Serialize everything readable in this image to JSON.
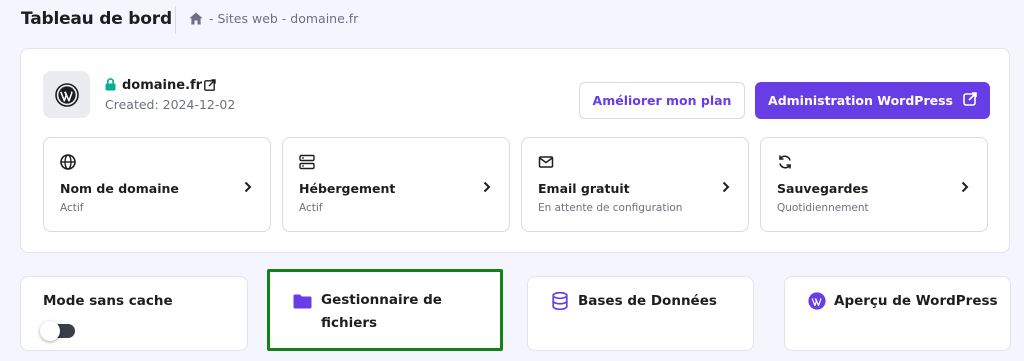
{
  "header": {
    "title": "Tableau de bord",
    "breadcrumb": "- Sites web - domaine.fr"
  },
  "site": {
    "name": "domaine.fr",
    "created": "Created: 2024-12-02",
    "logo_icon": "wordpress-icon",
    "lock_icon": "lock-icon",
    "external_icon": "external-link-icon"
  },
  "actions": {
    "upgrade_label": "Améliorer mon plan",
    "wp_admin_label": "Administration WordPress"
  },
  "services": [
    {
      "icon": "globe-icon",
      "title": "Nom de domaine",
      "status": "Actif"
    },
    {
      "icon": "server-icon",
      "title": "Hébergement",
      "status": "Actif"
    },
    {
      "icon": "mail-icon",
      "title": "Email gratuit",
      "status": "En attente de configuration"
    },
    {
      "icon": "refresh-icon",
      "title": "Sauvegardes",
      "status": "Quotidiennement"
    }
  ],
  "tiles": {
    "cache": {
      "title": "Mode sans cache",
      "toggle_on": false
    },
    "file_manager": {
      "title_line1": "Gestionnaire de",
      "title_line2": "fichiers",
      "icon": "folder-icon"
    },
    "databases": {
      "title": "Bases de Données",
      "icon": "database-icon"
    },
    "wp_preview": {
      "title": "Aperçu de WordPress",
      "icon": "wordpress-icon"
    }
  },
  "colors": {
    "accent": "#673de6",
    "success": "#00b090",
    "highlight": "#148214"
  }
}
